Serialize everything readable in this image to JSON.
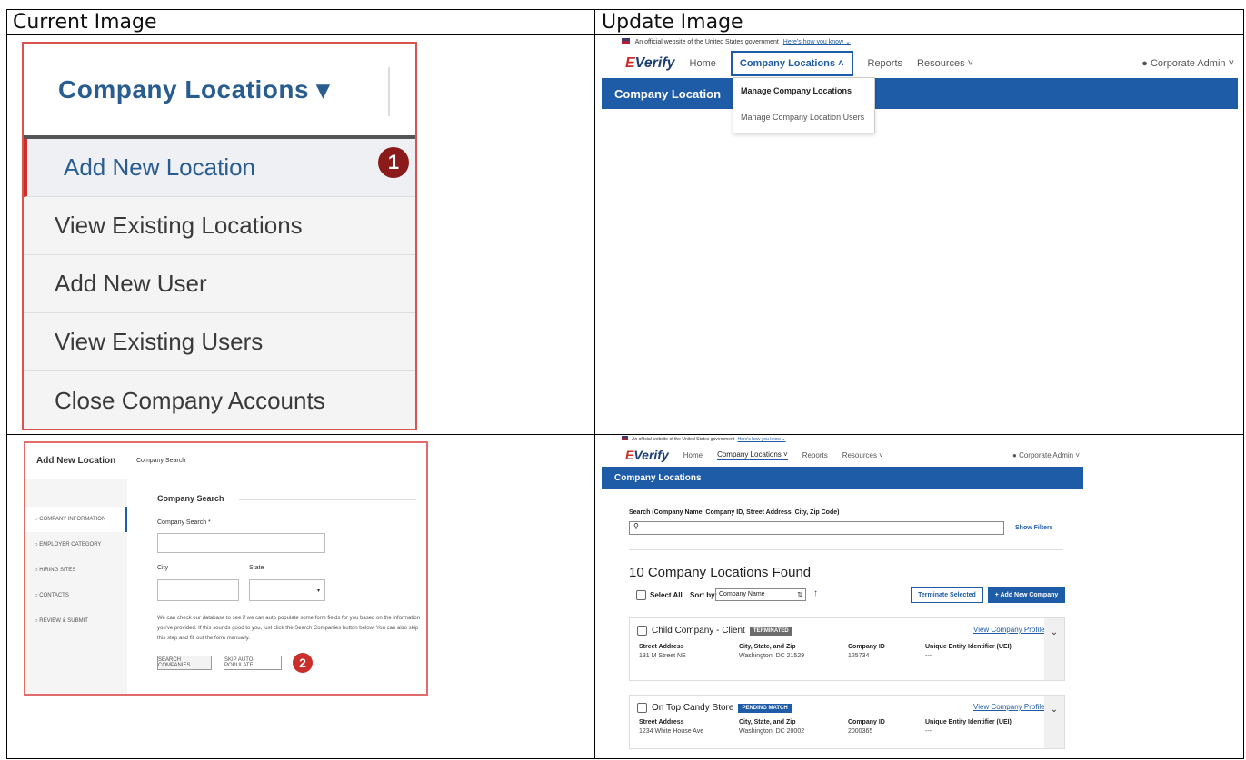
{
  "headers": {
    "current": "Current Image",
    "update": "Update Image"
  },
  "current1": {
    "title": "Company Locations ▾",
    "items": [
      "Add New Location",
      "View Existing Locations",
      "Add New User",
      "View Existing Users",
      "Close Company Accounts"
    ],
    "badge": "1"
  },
  "gov_banner": {
    "text": "An official website of the United States government",
    "link": "Here's how you know ⌄"
  },
  "nav": {
    "logo_e": "E",
    "logo_rest": "Verify",
    "home": "Home",
    "company_locations_open": "Company Locations ˄",
    "company_locations": "Company Locations ˅",
    "reports": "Reports",
    "resources": "Resources ˅",
    "user": "Corporate Admin ˅"
  },
  "update1": {
    "bar_title": "Company Location",
    "dropdown": [
      "Manage Company Locations",
      "Manage Company Location Users"
    ]
  },
  "current2": {
    "left_title": "Add New Location",
    "top_title": "Company Search",
    "steps": [
      "COMPANY INFORMATION",
      "EMPLOYER CATEGORY",
      "HIRING SITES",
      "CONTACTS",
      "REVIEW & SUBMIT"
    ],
    "section": "Company Search",
    "field_label": "Company Search *",
    "city": "City",
    "state": "State",
    "help": "We can check our database to see if we can auto populate some form fields for you based on the information you've provided. If this sounds good to you, just click the Search Companies button below. You can also skip this step and fill out the form manually.",
    "btn_search": "SEARCH COMPANIES",
    "btn_skip": "SKIP AUTO-POPULATE",
    "badge": "2"
  },
  "update2": {
    "bar_title": "Company Locations",
    "search_label": "Search (Company Name, Company ID, Street Address, City, Zip Code)",
    "show_filters": "Show Filters",
    "found": "10 Company Locations Found",
    "select_all": "Select All",
    "sort_by": "Sort by:",
    "sort_value": "Company Name",
    "terminate": "Terminate Selected",
    "add_new": "+ Add New Company",
    "cols": [
      "Street Address",
      "City, State, and Zip",
      "Company ID",
      "Unique Entity Identifier (UEI)"
    ],
    "cards": [
      {
        "name": "Child Company - Client",
        "tag": "TERMINATED",
        "tag_color": "#6b6b6b",
        "link": "View Company Profile",
        "street": "131 M Street NE",
        "city": "Washington, DC 21529",
        "id": "125734",
        "uei": "---"
      },
      {
        "name": "On Top Candy Store",
        "tag": "PENDING MATCH",
        "tag_color": "#1f5ca8",
        "link": "View Company Profile",
        "street": "1234 White House Ave",
        "city": "Washington, DC 20002",
        "id": "2000365",
        "uei": "---"
      }
    ]
  }
}
